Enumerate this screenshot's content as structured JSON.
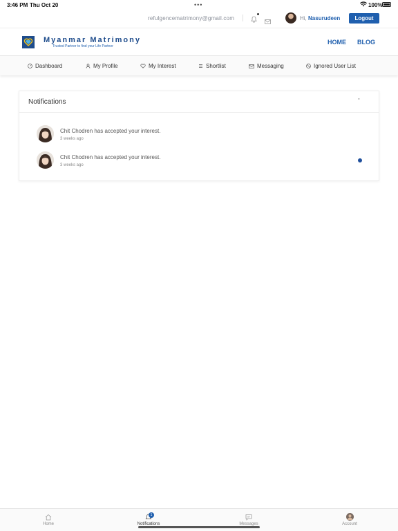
{
  "status_bar": {
    "time": "3:46 PM",
    "date": "Thu Oct 20",
    "battery": "100%"
  },
  "account_bar": {
    "email": "refulgencematrimony@gmail.com",
    "greeting_prefix": "Hi,",
    "user_name": "Nasurudeen",
    "logout_label": "Logout"
  },
  "brand": {
    "name": "Myanmar Matrimony",
    "tagline": "Trusted Partner to find your Life Partner",
    "colors": {
      "primary": "#1f5fae",
      "dark": "#1e4c8c"
    }
  },
  "main_nav": {
    "home": "HOME",
    "blog": "BLOG"
  },
  "tabs": [
    {
      "label": "Dashboard",
      "icon": "dashboard-icon"
    },
    {
      "label": "My Profile",
      "icon": "user-icon"
    },
    {
      "label": "My Interest",
      "icon": "heart-icon"
    },
    {
      "label": "Shortlist",
      "icon": "list-icon"
    },
    {
      "label": "Messaging",
      "icon": "mail-icon"
    },
    {
      "label": "Ignored User List",
      "icon": "block-icon"
    }
  ],
  "notifications": {
    "title": "Notifications",
    "items": [
      {
        "message": "Chit Chodren has accepted your interest.",
        "time": "3 weeks ago",
        "unread": false
      },
      {
        "message": "Chit Chodren has accepted your interest.",
        "time": "3 weeks ago",
        "unread": true
      }
    ]
  },
  "bottom_tabs": [
    {
      "label": "Home",
      "icon": "home-icon",
      "active": false
    },
    {
      "label": "Notifications",
      "icon": "bell-icon",
      "active": true,
      "badge": "1"
    },
    {
      "label": "Messages",
      "icon": "chat-icon",
      "active": false
    },
    {
      "label": "Account",
      "icon": "avatar-icon",
      "active": false
    }
  ]
}
